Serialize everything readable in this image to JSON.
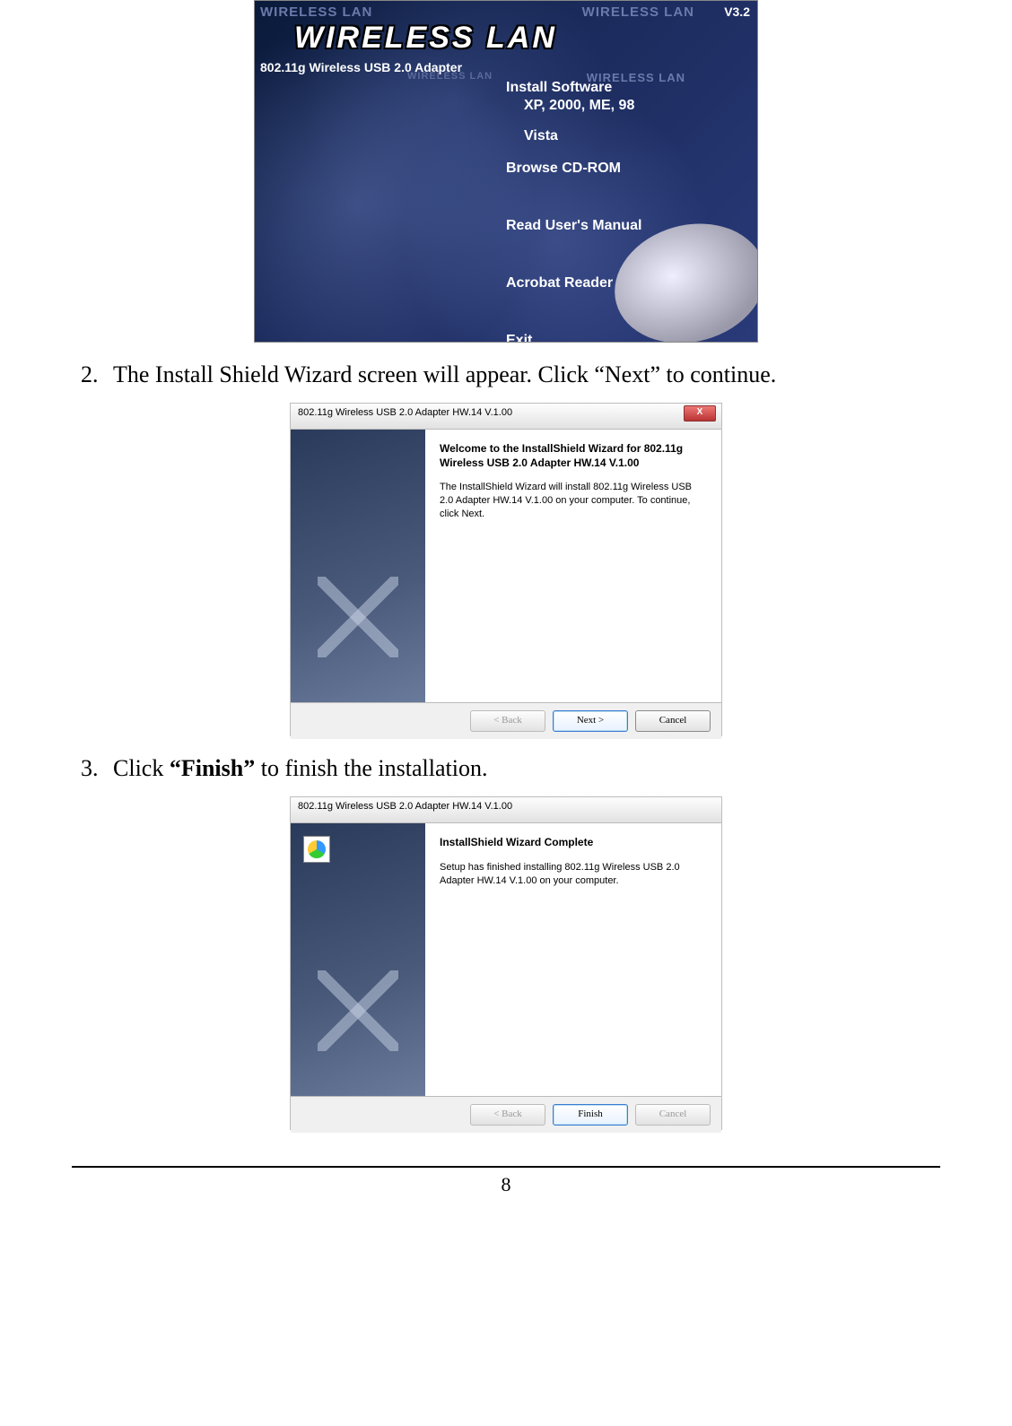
{
  "autorun": {
    "ghost_lan": "WIRELESS LAN",
    "version": "V3.2",
    "title": "WIRELESS LAN",
    "subtitle": "802.11g Wireless USB 2.0 Adapter",
    "menu": {
      "install": "Install Software",
      "install_os": "XP, 2000, ME, 98",
      "install_vista": "Vista",
      "browse": "Browse CD-ROM",
      "manual": "Read User's Manual",
      "acrobat": "Acrobat Reader",
      "exit": "Exit"
    }
  },
  "step2": {
    "num": "2.",
    "text": "The Install Shield Wizard screen will appear. Click “Next” to continue."
  },
  "wizard1": {
    "title": "802.11g Wireless USB 2.0 Adapter HW.14 V.1.00",
    "heading": "Welcome to the InstallShield Wizard for 802.11g Wireless USB 2.0 Adapter HW.14 V.1.00",
    "body": "The InstallShield Wizard will install 802.11g Wireless USB 2.0 Adapter HW.14 V.1.00 on your computer.  To continue, click Next.",
    "back": "< Back",
    "next": "Next >",
    "cancel": "Cancel",
    "close": "X"
  },
  "step3": {
    "num": "3.",
    "pre": "Click ",
    "bold": "“Finish”",
    "post": " to finish the installation."
  },
  "wizard2": {
    "title": "802.11g Wireless USB 2.0 Adapter HW.14 V.1.00",
    "heading": "InstallShield Wizard Complete",
    "body": "Setup has finished installing 802.11g Wireless USB 2.0 Adapter HW.14 V.1.00 on your computer.",
    "back": "< Back",
    "finish": "Finish",
    "cancel": "Cancel"
  },
  "page_number": "8"
}
